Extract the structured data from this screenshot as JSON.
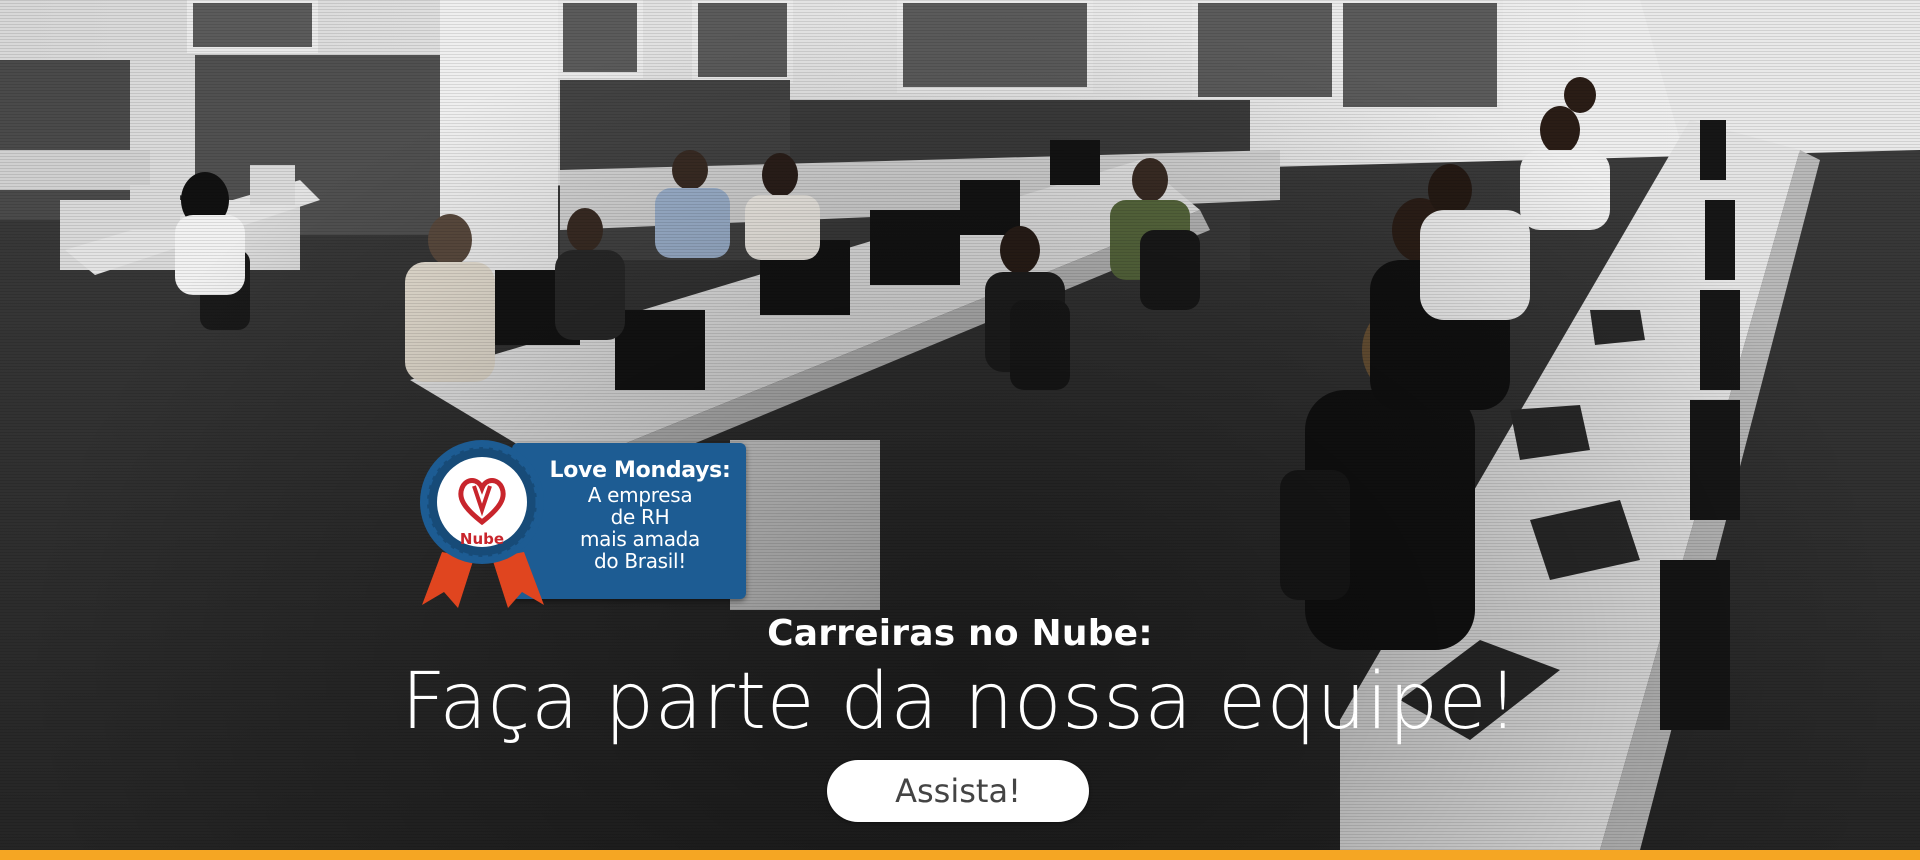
{
  "badge": {
    "logo_text": "Nube",
    "title": "Love Mondays:",
    "lines": [
      "A empresa",
      "de RH",
      "mais amada",
      "do Brasil!"
    ]
  },
  "hero": {
    "subtitle": "Carreiras no Nube:",
    "headline": "Faça parte da nossa equipe!",
    "button_label": "Assista!"
  },
  "colors": {
    "badge_blue": "#1d5c93",
    "seal_red": "#c8252c",
    "ribbon_orange": "#e0451f",
    "accent_bar": "#f5a623",
    "button_bg": "#ffffff",
    "button_text": "#444444"
  }
}
